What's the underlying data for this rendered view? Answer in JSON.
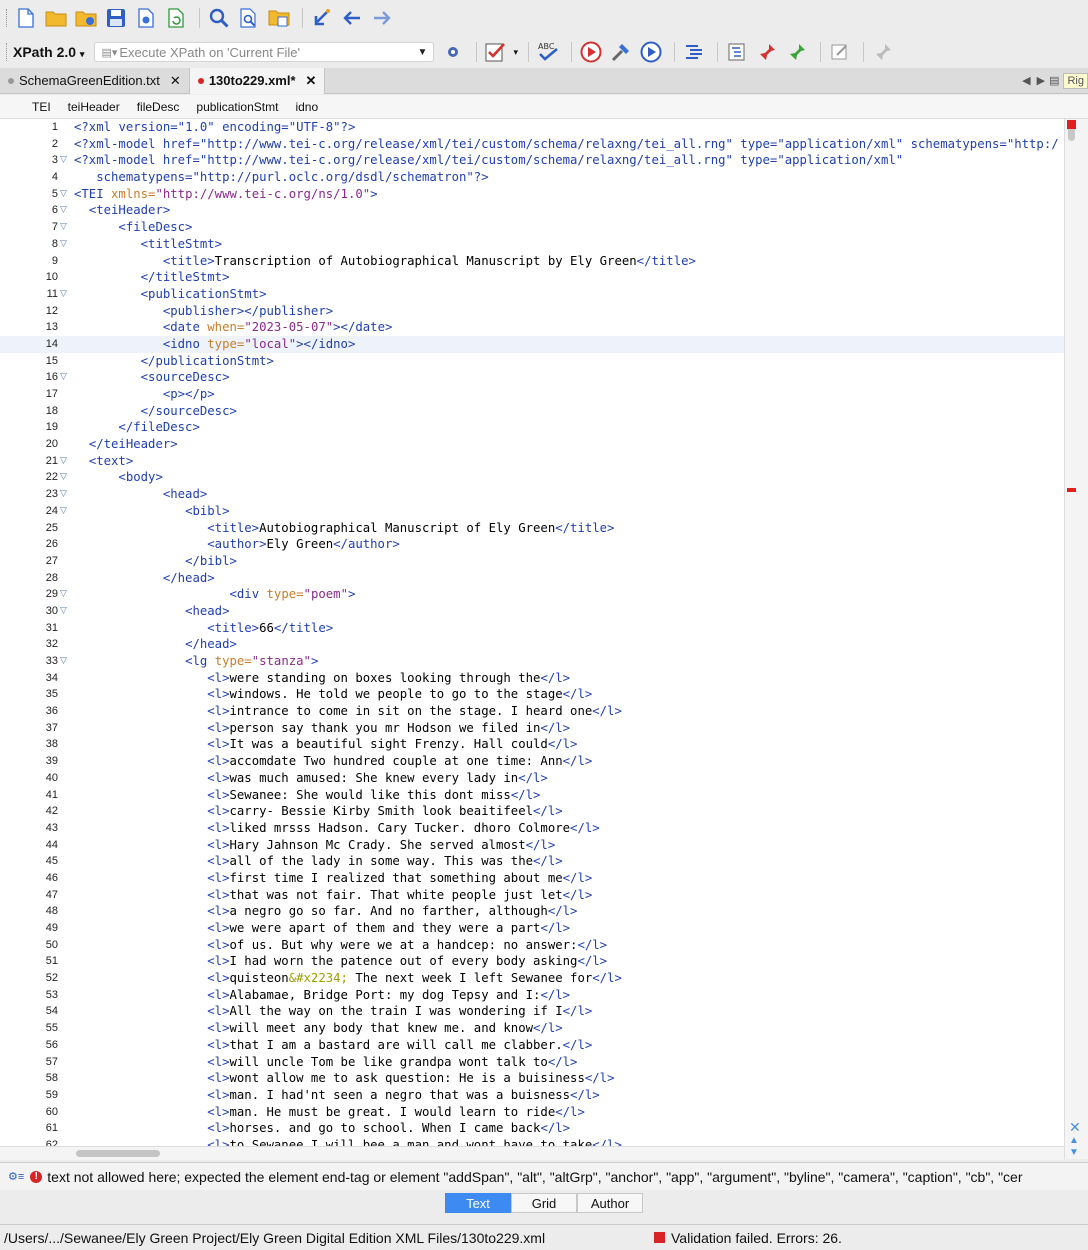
{
  "toolbar": {
    "icons": [
      "new-file-icon",
      "open-folder-icon",
      "open-url-icon",
      "save-icon",
      "print-icon",
      "reload-icon",
      "find-icon",
      "find-in-files-icon",
      "open-resource-icon",
      "back-icon",
      "back-arrow-icon",
      "forward-arrow-icon"
    ],
    "xpath_version": "XPath 2.0",
    "xpath_placeholder": "Execute XPath on  'Current File'"
  },
  "tabs": [
    {
      "label": "SchemaGreenEdition.txt",
      "active": false,
      "modified": false
    },
    {
      "label": "130to229.xml*",
      "active": true,
      "modified": true
    }
  ],
  "tabs_right_label": "Rig",
  "breadcrumb": [
    "TEI",
    "teiHeader",
    "fileDesc",
    "publicationStmt",
    "idno"
  ],
  "problem": {
    "message": "text not allowed here; expected the element end-tag or element \"addSpan\", \"alt\", \"altGrp\", \"anchor\", \"app\", \"argument\", \"byline\", \"camera\", \"caption\", \"cb\", \"cer"
  },
  "modes": [
    "Text",
    "Grid",
    "Author"
  ],
  "active_mode": "Text",
  "status": {
    "path": "/Users/.../Sewanee/Ely Green Project/Ely Green Digital Edition XML Files/130to229.xml",
    "validation": "Validation failed. Errors: 26."
  },
  "colors": {
    "accent": "#3d8bf2",
    "error": "#d82424",
    "tag": "#1f3fb0",
    "attr": "#c97d2a",
    "value": "#8a2a8a"
  },
  "code_lines": [
    {
      "n": "1",
      "fold": false,
      "html": "<span class=\"t\">&lt;?xml</span> <span class=\"t\">version=\"1.0\" encoding=\"UTF-8\"?&gt;</span>"
    },
    {
      "n": "2",
      "fold": false,
      "html": "<span class=\"t\">&lt;?xml-model href=\"http://www.tei-c.org/release/xml/tei/custom/schema/relaxng/tei_all.rng\" type=\"application/xml\" schematypens=\"http:/</span>"
    },
    {
      "n": "3",
      "fold": true,
      "html": "<span class=\"t\">&lt;?xml-model href=\"http://www.tei-c.org/release/xml/tei/custom/schema/relaxng/tei_all.rng\" type=\"application/xml\"</span>"
    },
    {
      "n": "4",
      "fold": false,
      "html": "   <span class=\"t\">schematypens=\"http://purl.oclc.org/dsdl/schematron\"?&gt;</span>"
    },
    {
      "n": "5",
      "fold": true,
      "html": "<span class=\"t\">&lt;TEI</span> <span class=\"a\">xmlns=</span><span class=\"v\">\"http://www.tei-c.org/ns/1.0\"</span><span class=\"t\">&gt;</span>"
    },
    {
      "n": "6",
      "fold": true,
      "html": "  <span class=\"t\">&lt;teiHeader&gt;</span>"
    },
    {
      "n": "7",
      "fold": true,
      "html": "      <span class=\"t\">&lt;fileDesc&gt;</span>"
    },
    {
      "n": "8",
      "fold": true,
      "html": "         <span class=\"t\">&lt;titleStmt&gt;</span>"
    },
    {
      "n": "9",
      "fold": false,
      "html": "            <span class=\"t\">&lt;title&gt;</span>Transcription of Autobiographical Manuscript by Ely Green<span class=\"t\">&lt;/title&gt;</span>"
    },
    {
      "n": "10",
      "fold": false,
      "html": "         <span class=\"t\">&lt;/titleStmt&gt;</span>"
    },
    {
      "n": "11",
      "fold": true,
      "html": "         <span class=\"t\">&lt;publicationStmt&gt;</span>"
    },
    {
      "n": "12",
      "fold": false,
      "html": "            <span class=\"t\">&lt;publisher&gt;&lt;/publisher&gt;</span>"
    },
    {
      "n": "13",
      "fold": false,
      "html": "            <span class=\"t\">&lt;date</span> <span class=\"a\">when=</span><span class=\"v\">\"2023-05-07\"</span><span class=\"t\">&gt;&lt;/date&gt;</span>"
    },
    {
      "n": "14",
      "fold": false,
      "cur": true,
      "html": "            <span class=\"t\">&lt;idno</span> <span class=\"a\">type=</span><span class=\"v\">\"local\"</span><span class=\"t\">&gt;&lt;/idno&gt;</span>"
    },
    {
      "n": "15",
      "fold": false,
      "html": "         <span class=\"t\">&lt;/publicationStmt&gt;</span>"
    },
    {
      "n": "16",
      "fold": true,
      "html": "         <span class=\"t\">&lt;sourceDesc&gt;</span>"
    },
    {
      "n": "17",
      "fold": false,
      "html": "            <span class=\"t\">&lt;p&gt;&lt;/p&gt;</span>"
    },
    {
      "n": "18",
      "fold": false,
      "html": "         <span class=\"t\">&lt;/sourceDesc&gt;</span>"
    },
    {
      "n": "19",
      "fold": false,
      "html": "      <span class=\"t\">&lt;/fileDesc&gt;</span>"
    },
    {
      "n": "20",
      "fold": false,
      "html": "  <span class=\"t\">&lt;/teiHeader&gt;</span>"
    },
    {
      "n": "21",
      "fold": true,
      "html": "  <span class=\"t\">&lt;text&gt;</span>"
    },
    {
      "n": "22",
      "fold": true,
      "html": "      <span class=\"t\">&lt;body&gt;</span>"
    },
    {
      "n": "23",
      "fold": true,
      "html": "            <span class=\"t\">&lt;head&gt;</span>"
    },
    {
      "n": "24",
      "fold": true,
      "html": "               <span class=\"t\">&lt;bibl&gt;</span>"
    },
    {
      "n": "25",
      "fold": false,
      "html": "                  <span class=\"t\">&lt;title&gt;</span>Autobiographical Manuscript of Ely Green<span class=\"t\">&lt;/title&gt;</span>"
    },
    {
      "n": "26",
      "fold": false,
      "html": "                  <span class=\"t\">&lt;author&gt;</span>Ely Green<span class=\"t\">&lt;/author&gt;</span>"
    },
    {
      "n": "27",
      "fold": false,
      "html": "               <span class=\"t\">&lt;/bibl&gt;</span>"
    },
    {
      "n": "28",
      "fold": false,
      "html": "            <span class=\"t\">&lt;/head&gt;</span>"
    },
    {
      "n": "29",
      "fold": true,
      "html": "                     <span class=\"t\">&lt;div</span> <span class=\"a\">type=</span><span class=\"v\">\"poem\"</span><span class=\"t\">&gt;</span>"
    },
    {
      "n": "30",
      "fold": true,
      "html": "               <span class=\"t\">&lt;head&gt;</span>"
    },
    {
      "n": "31",
      "fold": false,
      "html": "                  <span class=\"t\">&lt;title&gt;</span>66<span class=\"t\">&lt;/title&gt;</span>"
    },
    {
      "n": "32",
      "fold": false,
      "html": "               <span class=\"t\">&lt;/head&gt;</span>"
    },
    {
      "n": "33",
      "fold": true,
      "html": "               <span class=\"t\">&lt;lg</span> <span class=\"a\">type=</span><span class=\"v\">\"stanza\"</span><span class=\"t\">&gt;</span>"
    },
    {
      "n": "34",
      "fold": false,
      "html": "                  <span class=\"t\">&lt;l&gt;</span>were standing on boxes looking through the<span class=\"t\">&lt;/l&gt;</span>"
    },
    {
      "n": "35",
      "fold": false,
      "html": "                  <span class=\"t\">&lt;l&gt;</span>windows. He told we people to go to the stage<span class=\"t\">&lt;/l&gt;</span>"
    },
    {
      "n": "36",
      "fold": false,
      "html": "                  <span class=\"t\">&lt;l&gt;</span>intrance to come in sit on the stage. I heard one<span class=\"t\">&lt;/l&gt;</span>"
    },
    {
      "n": "37",
      "fold": false,
      "html": "                  <span class=\"t\">&lt;l&gt;</span>person say thank you mr Hodson we filed in<span class=\"t\">&lt;/l&gt;</span>"
    },
    {
      "n": "38",
      "fold": false,
      "html": "                  <span class=\"t\">&lt;l&gt;</span>It was a beautiful sight Frenzy. Hall could<span class=\"t\">&lt;/l&gt;</span>"
    },
    {
      "n": "39",
      "fold": false,
      "html": "                  <span class=\"t\">&lt;l&gt;</span>accomdate Two hundred couple at one time: Ann<span class=\"t\">&lt;/l&gt;</span>"
    },
    {
      "n": "40",
      "fold": false,
      "html": "                  <span class=\"t\">&lt;l&gt;</span>was much amused: She knew every lady in<span class=\"t\">&lt;/l&gt;</span>"
    },
    {
      "n": "41",
      "fold": false,
      "html": "                  <span class=\"t\">&lt;l&gt;</span>Sewanee: She would like this dont miss<span class=\"t\">&lt;/l&gt;</span>"
    },
    {
      "n": "42",
      "fold": false,
      "html": "                  <span class=\"t\">&lt;l&gt;</span>carry- Bessie Kirby Smith look beaitifeel<span class=\"t\">&lt;/l&gt;</span>"
    },
    {
      "n": "43",
      "fold": false,
      "html": "                  <span class=\"t\">&lt;l&gt;</span>liked mrsss Hadson. Cary Tucker. dhoro Colmore<span class=\"t\">&lt;/l&gt;</span>"
    },
    {
      "n": "44",
      "fold": false,
      "html": "                  <span class=\"t\">&lt;l&gt;</span>Hary Jahnson Mc Crady. She served almost<span class=\"t\">&lt;/l&gt;</span>"
    },
    {
      "n": "45",
      "fold": false,
      "html": "                  <span class=\"t\">&lt;l&gt;</span>all of the lady in some way. This was the<span class=\"t\">&lt;/l&gt;</span>"
    },
    {
      "n": "46",
      "fold": false,
      "html": "                  <span class=\"t\">&lt;l&gt;</span>first time I realized that something about me<span class=\"t\">&lt;/l&gt;</span>"
    },
    {
      "n": "47",
      "fold": false,
      "html": "                  <span class=\"t\">&lt;l&gt;</span>that was not fair. That white people just let<span class=\"t\">&lt;/l&gt;</span>"
    },
    {
      "n": "48",
      "fold": false,
      "html": "                  <span class=\"t\">&lt;l&gt;</span>a negro go so far. And no farther, although<span class=\"t\">&lt;/l&gt;</span>"
    },
    {
      "n": "49",
      "fold": false,
      "html": "                  <span class=\"t\">&lt;l&gt;</span>we were apart of them and they were a part<span class=\"t\">&lt;/l&gt;</span>"
    },
    {
      "n": "50",
      "fold": false,
      "html": "                  <span class=\"t\">&lt;l&gt;</span>of us. But why were we at a handcep: no answer:<span class=\"t\">&lt;/l&gt;</span>"
    },
    {
      "n": "51",
      "fold": false,
      "html": "                  <span class=\"t\">&lt;l&gt;</span>I had worn the patence out of every body asking<span class=\"t\">&lt;/l&gt;</span>"
    },
    {
      "n": "52",
      "fold": false,
      "html": "                  <span class=\"t\">&lt;l&gt;</span>quisteon<span class=\"ent\">&amp;#x2234;</span> The next week I left Sewanee for<span class=\"t\">&lt;/l&gt;</span>"
    },
    {
      "n": "53",
      "fold": false,
      "html": "                  <span class=\"t\">&lt;l&gt;</span>Alabamae, Bridge Port: my dog Tepsy and I:<span class=\"t\">&lt;/l&gt;</span>"
    },
    {
      "n": "54",
      "fold": false,
      "html": "                  <span class=\"t\">&lt;l&gt;</span>All the way on the train I was wondering if I<span class=\"t\">&lt;/l&gt;</span>"
    },
    {
      "n": "55",
      "fold": false,
      "html": "                  <span class=\"t\">&lt;l&gt;</span>will meet any body that knew me. and know<span class=\"t\">&lt;/l&gt;</span>"
    },
    {
      "n": "56",
      "fold": false,
      "html": "                  <span class=\"t\">&lt;l&gt;</span>that I am a bastard are will call me clabber.<span class=\"t\">&lt;/l&gt;</span>"
    },
    {
      "n": "57",
      "fold": false,
      "html": "                  <span class=\"t\">&lt;l&gt;</span>will uncle Tom be like grandpa wont talk to<span class=\"t\">&lt;/l&gt;</span>"
    },
    {
      "n": "58",
      "fold": false,
      "html": "                  <span class=\"t\">&lt;l&gt;</span>wont allow me to ask question: He is a buisiness<span class=\"t\">&lt;/l&gt;</span>"
    },
    {
      "n": "59",
      "fold": false,
      "html": "                  <span class=\"t\">&lt;l&gt;</span>man. I had'nt seen a negro that was a buisness<span class=\"t\">&lt;/l&gt;</span>"
    },
    {
      "n": "60",
      "fold": false,
      "html": "                  <span class=\"t\">&lt;l&gt;</span>man. He must be great. I would learn to ride<span class=\"t\">&lt;/l&gt;</span>"
    },
    {
      "n": "61",
      "fold": false,
      "html": "                  <span class=\"t\">&lt;l&gt;</span>horses. and go to school. When I came back<span class=\"t\">&lt;/l&gt;</span>"
    },
    {
      "n": "62",
      "fold": false,
      "html": "                  <span class=\"t\">&lt;l&gt;</span>to Sewanee I will bee a man and wont have to take<span class=\"t\">&lt;/l&gt;</span>"
    }
  ]
}
